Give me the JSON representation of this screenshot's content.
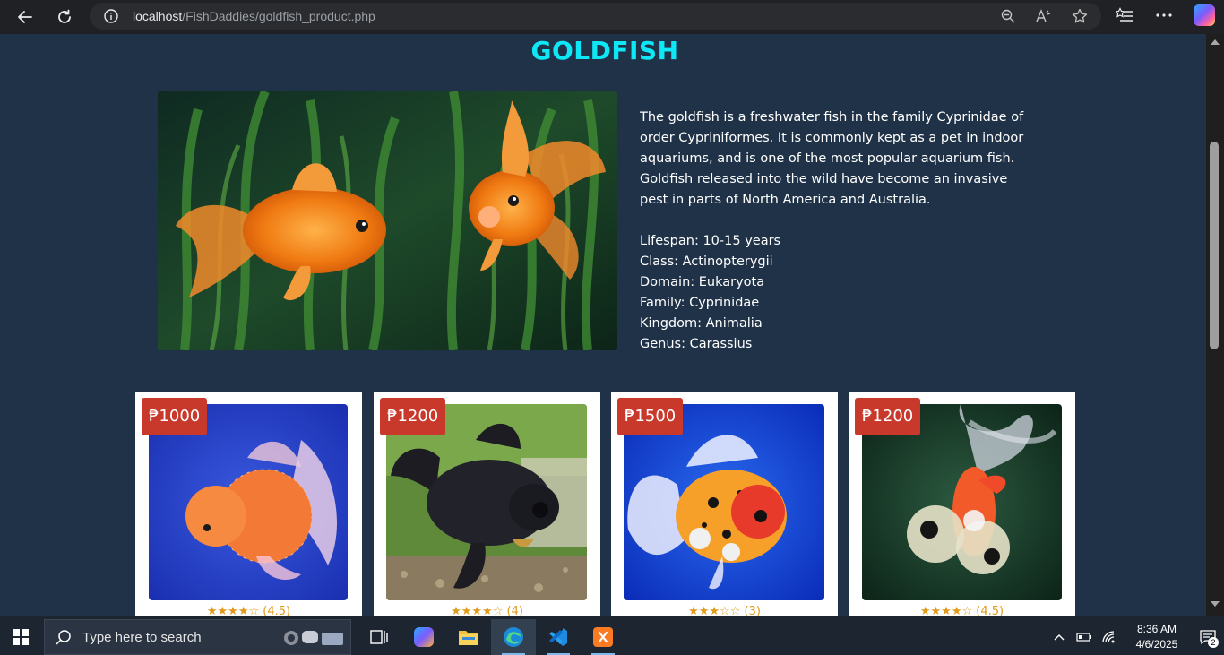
{
  "browser": {
    "url_host": "localhost",
    "url_path": "/FishDaddies/goldfish_product.php"
  },
  "page": {
    "title": "GOLDFISH",
    "description": "The goldfish is a freshwater fish in the family Cyprinidae of order Cypriniformes. It is commonly kept as a pet in indoor aquariums, and is one of the most popular aquarium fish. Goldfish released into the wild have become an invasive pest in parts of North America and Australia.",
    "facts": [
      "Lifespan: 10-15 years",
      "Class: Actinopterygii",
      "Domain: Eukaryota",
      "Family: Cyprinidae",
      "Kingdom: Animalia",
      "Genus: Carassius"
    ],
    "products": [
      {
        "price": "₱1000",
        "stars": "★★★★☆",
        "rating": "(4.5)",
        "rating_value": 4.5
      },
      {
        "price": "₱1200",
        "stars": "★★★★☆",
        "rating": "(4)",
        "rating_value": 4
      },
      {
        "price": "₱1500",
        "stars": "★★★☆☆",
        "rating": "(3)",
        "rating_value": 3
      },
      {
        "price": "₱1200",
        "stars": "★★★★☆",
        "rating": "(4.5)",
        "rating_value": 4.5
      }
    ]
  },
  "taskbar": {
    "search_placeholder": "Type here to search",
    "time": "8:36 AM",
    "date": "4/6/2025",
    "notification_count": "2"
  },
  "colors": {
    "page_bg": "#1f3248",
    "title": "#0ee8f6",
    "price_badge": "#c8392b",
    "rating": "#e09a1a"
  }
}
